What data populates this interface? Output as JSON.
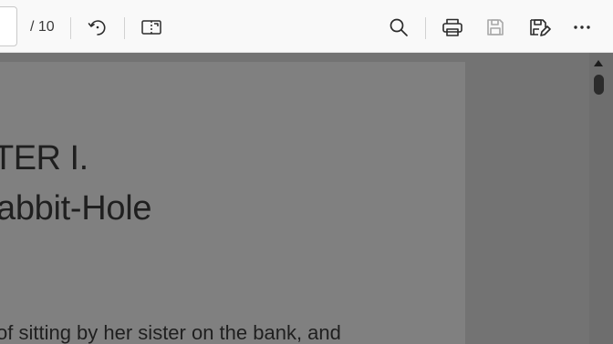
{
  "toolbar": {
    "page_total": "/ 10",
    "icons": {
      "rotate": "rotate-icon",
      "page_view": "page-view-icon",
      "search": "search-icon",
      "print": "print-icon",
      "save": "save-icon",
      "save_as": "save-as-icon",
      "more": "more-icon"
    }
  },
  "document": {
    "chapter_heading": "TER I.",
    "chapter_subtitle": "abbit-Hole",
    "body_line": "of sitting by her sister on the bank, and"
  }
}
